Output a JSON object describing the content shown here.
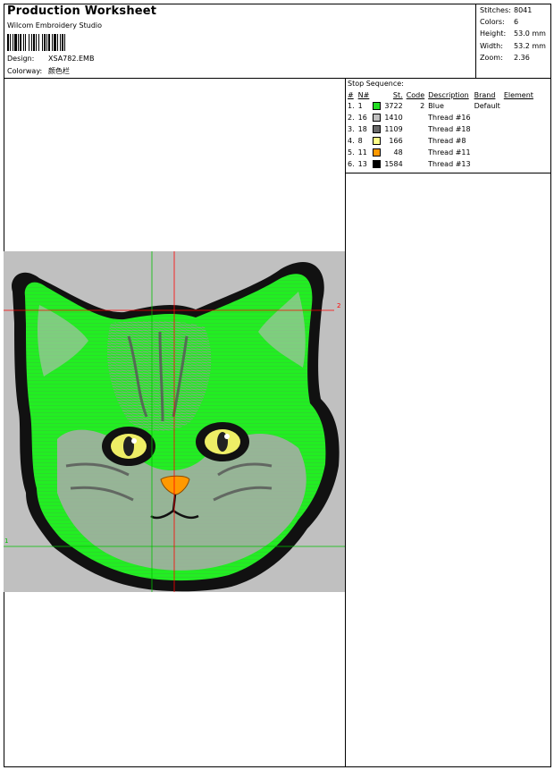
{
  "header": {
    "title": "Production Worksheet",
    "software": "Wilcom  Embroidery Studio",
    "design_label": "Design:",
    "design_value": "XSA782.EMB",
    "colorway_label": "Colorway:",
    "colorway_value": "颜色栏"
  },
  "stats": [
    {
      "label": "Stitches:",
      "value": "8041"
    },
    {
      "label": "Colors:",
      "value": "6"
    },
    {
      "label": "Height:",
      "value": "53.0 mm"
    },
    {
      "label": "Width:",
      "value": "53.2 mm"
    },
    {
      "label": "Zoom:",
      "value": "2.36"
    }
  ],
  "stop_sequence": {
    "title": "Stop Sequence:",
    "columns": [
      "#",
      "N#",
      "St.",
      "Code",
      "Description",
      "Brand",
      "Element"
    ],
    "rows": [
      {
        "idx": "1.",
        "n": "1",
        "color": "#22dd22",
        "st": "3722",
        "code": "2",
        "description": "Blue",
        "brand": "Default",
        "element": ""
      },
      {
        "idx": "2.",
        "n": "16",
        "color": "#c0c0c0",
        "st": "1410",
        "code": "",
        "description": "Thread #16",
        "brand": "",
        "element": ""
      },
      {
        "idx": "3.",
        "n": "18",
        "color": "#6a6a6a",
        "st": "1109",
        "code": "",
        "description": "Thread #18",
        "brand": "",
        "element": ""
      },
      {
        "idx": "4.",
        "n": "8",
        "color": "#ffff88",
        "st": "166",
        "code": "",
        "description": "Thread #8",
        "brand": "",
        "element": ""
      },
      {
        "idx": "5.",
        "n": "11",
        "color": "#ff9900",
        "st": "48",
        "code": "",
        "description": "Thread #11",
        "brand": "",
        "element": ""
      },
      {
        "idx": "6.",
        "n": "13",
        "color": "#000000",
        "st": "1584",
        "code": "",
        "description": "Thread #13",
        "brand": "",
        "element": ""
      }
    ]
  },
  "preview": {
    "background": "#c0c0c0",
    "guide_colors": {
      "red": "#ff0000",
      "green": "#00c000"
    },
    "marker_1": "1",
    "marker_2": "2"
  }
}
